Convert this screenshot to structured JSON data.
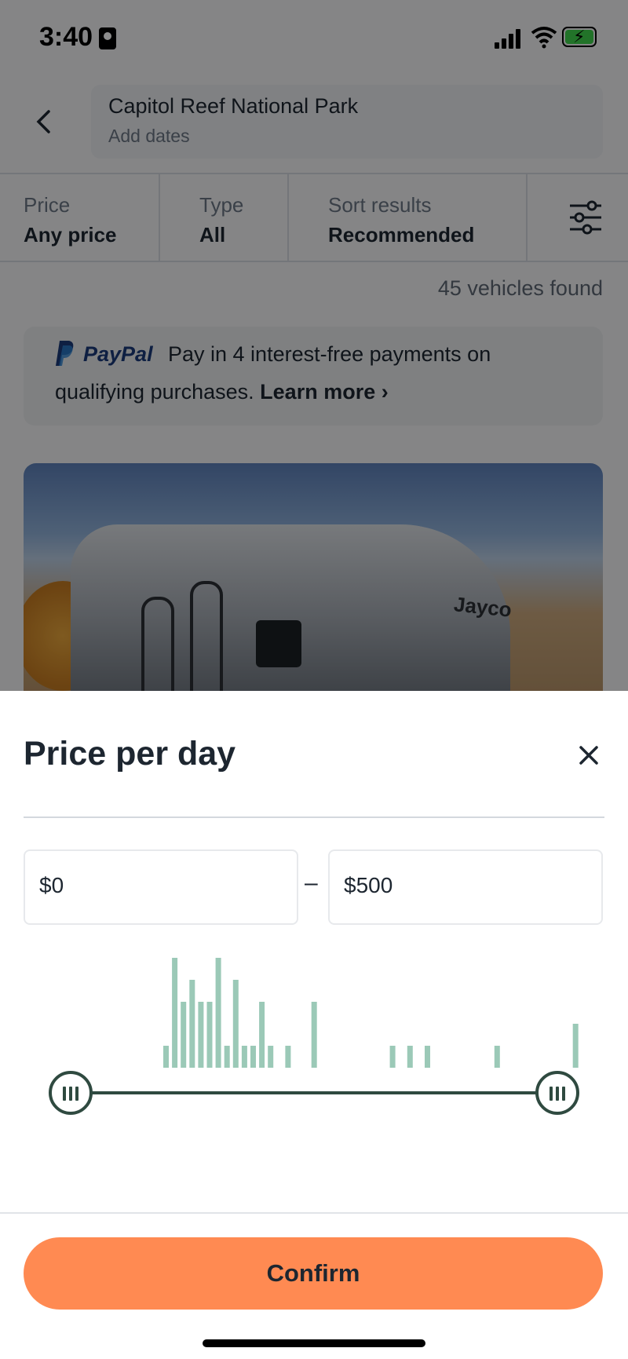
{
  "status_bar": {
    "time": "3:40"
  },
  "header": {
    "location": "Capitol Reef National Park",
    "dates_placeholder": "Add dates"
  },
  "filters": [
    {
      "label": "Price",
      "value": "Any price"
    },
    {
      "label": "Type",
      "value": "All"
    },
    {
      "label": "Sort results",
      "value": "Recommended"
    }
  ],
  "results": {
    "count_text": "45 vehicles found"
  },
  "paypal_banner": {
    "brand": "PayPal",
    "text1": "Pay in 4 interest-free payments on",
    "text2": "qualifying purchases.",
    "link": "Learn more ›"
  },
  "listing_photo": {
    "brand_text": "Jayco"
  },
  "sheet": {
    "title": "Price per day",
    "min_value": "$0",
    "max_value": "$500",
    "separator": "–",
    "confirm_label": "Confirm",
    "slider": {
      "min_fraction": 0.0,
      "max_fraction": 1.0
    },
    "histogram_color": "#9bc9b7",
    "histogram_counts": [
      1,
      5,
      3,
      4,
      3,
      3,
      5,
      1,
      4,
      1,
      1,
      3,
      1,
      0,
      1,
      0,
      0,
      3,
      0,
      0,
      0,
      0,
      0,
      0,
      0,
      0,
      1,
      0,
      1,
      0,
      1,
      0,
      0,
      0,
      0,
      0,
      0,
      0,
      1,
      0,
      0,
      0,
      0,
      0,
      0,
      0,
      0,
      2
    ]
  },
  "colors": {
    "accent": "#ff8a52",
    "slider": "#2f4a40"
  }
}
